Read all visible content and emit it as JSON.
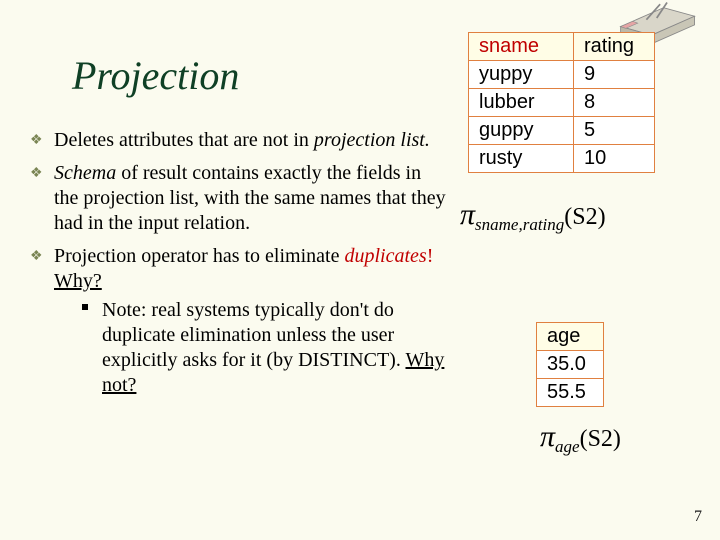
{
  "title": "Projection",
  "bullets": {
    "b1_pre": "Deletes attributes that are not in ",
    "b1_it": "projection list.",
    "b2_it": "Schema",
    "b2_rest": " of result contains exactly the fields in the projection list, with the same names that they had in the input relation.",
    "b3_pre": "Projection operator has to eliminate ",
    "b3_dup": "duplicates",
    "b3_bang": "!  ",
    "b3_why": "Why?",
    "b3_sub_pre": "Note: real systems typically don't do duplicate elimination unless the user explicitly asks for it (by DISTINCT).  ",
    "b3_sub_why": "Why not?"
  },
  "table1": {
    "headers": [
      "sname",
      "rating"
    ],
    "rows": [
      [
        "yuppy",
        "9"
      ],
      [
        "lubber",
        "8"
      ],
      [
        "guppy",
        "5"
      ],
      [
        "rusty",
        "10"
      ]
    ]
  },
  "table2": {
    "header": "age",
    "rows": [
      "35.0",
      "55.5"
    ]
  },
  "formula1": {
    "pi": "π",
    "sub": "sname,rating",
    "arg": "(S2)"
  },
  "formula2": {
    "pi": "π",
    "sub": "age",
    "arg": "(S2)"
  },
  "page_number": "7",
  "chart_data": [
    {
      "type": "table",
      "title": "π sname,rating (S2)",
      "columns": [
        "sname",
        "rating"
      ],
      "rows": [
        [
          "yuppy",
          9
        ],
        [
          "lubber",
          8
        ],
        [
          "guppy",
          5
        ],
        [
          "rusty",
          10
        ]
      ]
    },
    {
      "type": "table",
      "title": "π age (S2)",
      "columns": [
        "age"
      ],
      "rows": [
        [
          35.0
        ],
        [
          55.5
        ]
      ]
    }
  ]
}
